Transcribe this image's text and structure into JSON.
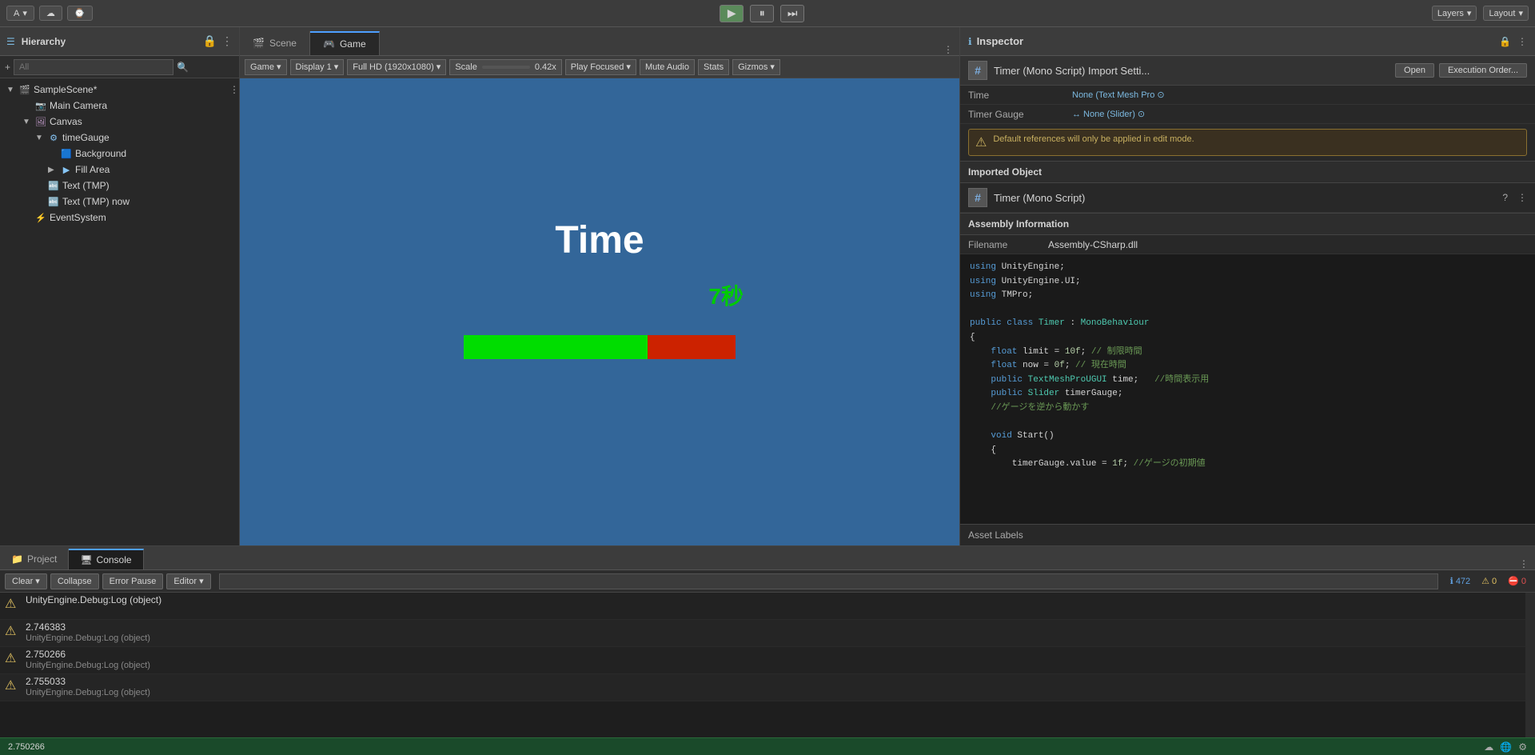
{
  "toolbar": {
    "account": "A",
    "cloud_icon": "☁",
    "history_icon": "⌚",
    "play_label": "▶",
    "pause_label": "⏸",
    "step_label": "⏭",
    "layers_label": "Layers",
    "layout_label": "Layout",
    "search_icon": "🔍"
  },
  "hierarchy": {
    "title": "Hierarchy",
    "search_placeholder": "All",
    "items": [
      {
        "indent": 0,
        "icon": "🎬",
        "label": "SampleScene*",
        "type": "scene",
        "has_arrow": true
      },
      {
        "indent": 1,
        "icon": "📷",
        "label": "Main Camera",
        "type": "camera",
        "has_arrow": false
      },
      {
        "indent": 1,
        "icon": "🖼",
        "label": "Canvas",
        "type": "canvas",
        "has_arrow": true
      },
      {
        "indent": 2,
        "icon": "⚙",
        "label": "timeGauge",
        "type": "gameobj",
        "has_arrow": true
      },
      {
        "indent": 3,
        "icon": "🟦",
        "label": "Background",
        "type": "gameobj",
        "has_arrow": false
      },
      {
        "indent": 3,
        "icon": "▶",
        "label": "Fill Area",
        "type": "gameobj",
        "has_arrow": true
      },
      {
        "indent": 2,
        "icon": "🔤",
        "label": "Text (TMP)",
        "type": "text",
        "has_arrow": false
      },
      {
        "indent": 2,
        "icon": "🔤",
        "label": "Text (TMP) now",
        "type": "text",
        "has_arrow": false
      },
      {
        "indent": 1,
        "icon": "⚡",
        "label": "EventSystem",
        "type": "eventsystem",
        "has_arrow": false
      }
    ]
  },
  "tabs": {
    "scene_label": "Scene",
    "game_label": "Game",
    "scene_icon": "🎬",
    "game_icon": "🎮"
  },
  "game_toolbar": {
    "display_label": "Game",
    "display1_label": "Display 1",
    "resolution_label": "Full HD (1920x1080)",
    "scale_label": "Scale",
    "scale_value": "0.42x",
    "play_focused_label": "Play Focused",
    "mute_label": "Mute Audio",
    "stats_label": "Stats",
    "gizmos_label": "Gizmos"
  },
  "game_view": {
    "time_text": "Time",
    "timer_value": "7秒",
    "bg_color": "#336699"
  },
  "inspector": {
    "title": "Inspector",
    "lock_icon": "🔒",
    "component_name": "Timer (Mono Script) Import Setti...",
    "open_label": "Open",
    "exec_order_label": "Execution Order...",
    "fields": [
      {
        "label": "Time",
        "value": "None (Text Mesh Pro ⊙"
      },
      {
        "label": "Timer Gauge",
        "value": "↔ None (Slider) ⊙"
      }
    ],
    "warning_text": "Default references will only be applied in edit mode.",
    "imported_object_title": "Imported Object",
    "imported_icon": "#",
    "imported_name": "Timer (Mono Script)",
    "assembly_title": "Assembly Information",
    "filename_label": "Filename",
    "filename_value": "Assembly-CSharp.dll",
    "code_lines": [
      "using UnityEngine;",
      "using UnityEngine.UI;",
      "using TMPro;",
      "",
      "public class Timer : MonoBehaviour",
      "{",
      "    float limit = 10f; // 制限時間",
      "    float now = 0f; // 現在時間",
      "    public TextMeshProUGUI time;   //時間表示用",
      "    public Slider timerGauge;",
      "    //ゲージを逆から動かす",
      "",
      "    void Start()",
      "    {",
      "        timerGauge.value = 1f; //ゲージの初期値"
    ],
    "asset_labels": "Asset Labels"
  },
  "console": {
    "project_label": "Project",
    "console_label": "Console",
    "clear_label": "Clear",
    "collapse_label": "Collapse",
    "error_pause_label": "Error Pause",
    "editor_label": "Editor",
    "search_placeholder": "",
    "badge_info": "472",
    "badge_warn": "0",
    "badge_error": "0",
    "entries": [
      {
        "type": "warn",
        "value": "UnityEngine.Debug:Log (object)",
        "source": ""
      },
      {
        "type": "warn",
        "value": "2.746383",
        "source": "UnityEngine.Debug:Log (object)"
      },
      {
        "type": "warn",
        "value": "2.750266",
        "source": "UnityEngine.Debug:Log (object)"
      },
      {
        "type": "warn",
        "value": "2.755033",
        "source": "UnityEngine.Debug:Log (object)"
      }
    ]
  },
  "status_bar": {
    "value": "2.750266"
  }
}
